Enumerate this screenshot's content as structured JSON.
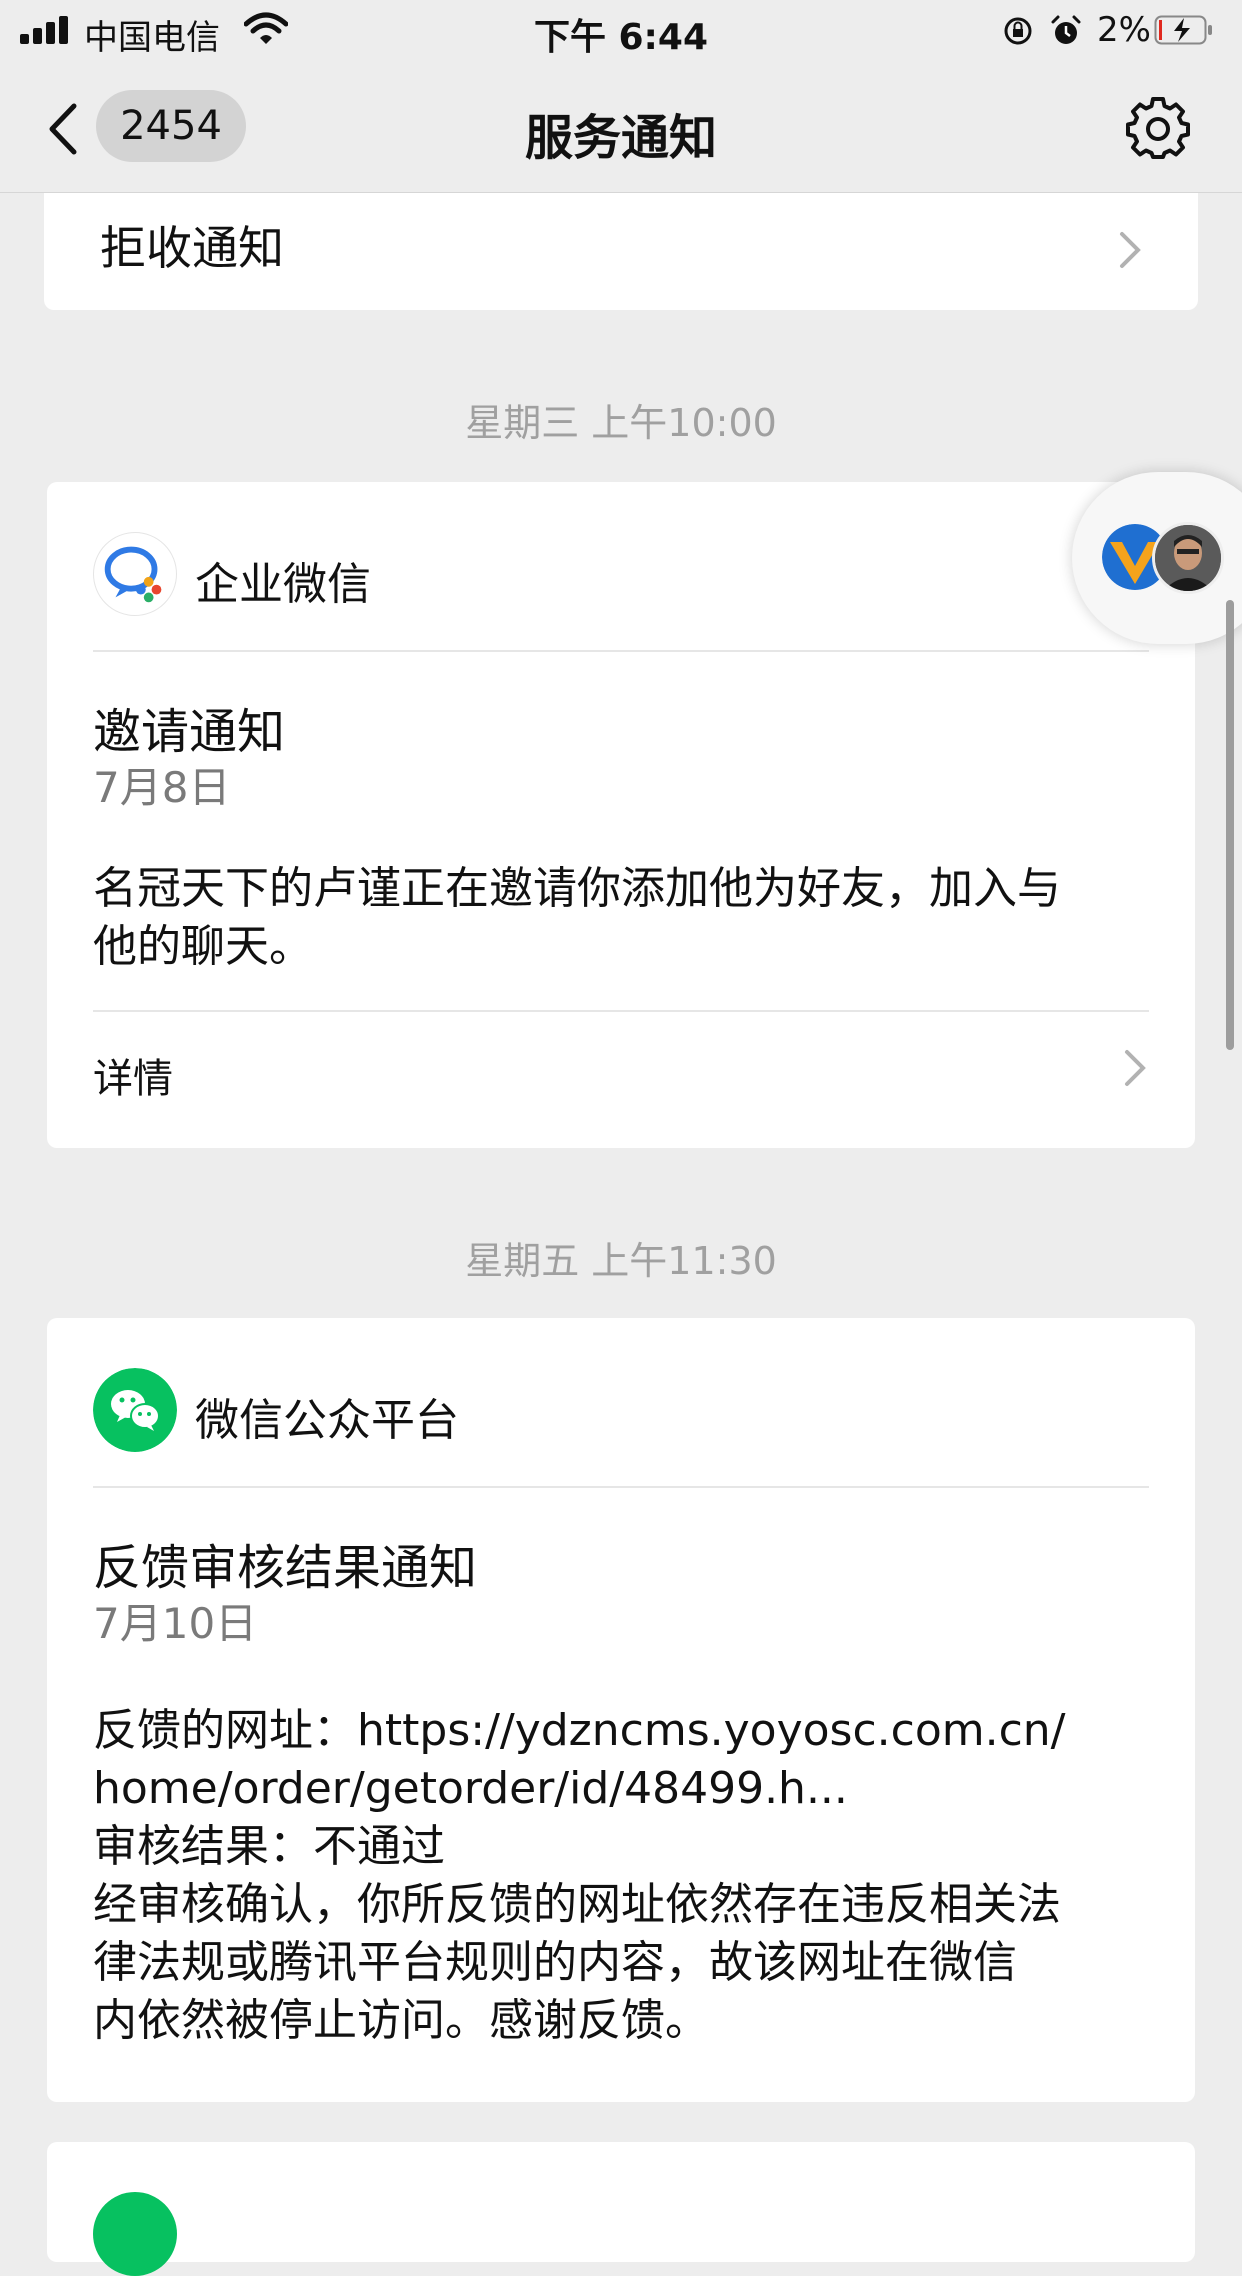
{
  "status_bar": {
    "carrier": "中国电信",
    "time": "下午 6:44",
    "battery": "2%"
  },
  "nav": {
    "unread_count": "2454",
    "title": "服务通知"
  },
  "refuse_item": {
    "label": "拒收通知"
  },
  "messages": [
    {
      "timestamp": "星期三 上午10:00",
      "app_name": "企业微信",
      "app_icon": "wecom-icon",
      "title": "邀请通知",
      "date": "7月8日",
      "body_lines": [
        "名冠天下的卢谨正在邀请你添加他为好友，加入与",
        "他的聊天。"
      ],
      "detail_label": "详情"
    },
    {
      "timestamp": "星期五 上午11:30",
      "app_name": "微信公众平台",
      "app_icon": "wechat-icon",
      "title": "反馈审核结果通知",
      "date": "7月10日",
      "body_lines": [
        "反馈的网址：https://ydzncms.yoyosc.com.cn/",
        "home/order/getorder/id/48499.h...",
        "审核结果：不通过",
        "经审核确认，你所反馈的网址依然存在违反相关法",
        "律法规或腾讯平台规则的内容，故该网址在微信",
        "内依然被停止访问。感谢反馈。"
      ]
    }
  ],
  "colors": {
    "wechat_green": "#07c160",
    "background": "#ededed"
  }
}
